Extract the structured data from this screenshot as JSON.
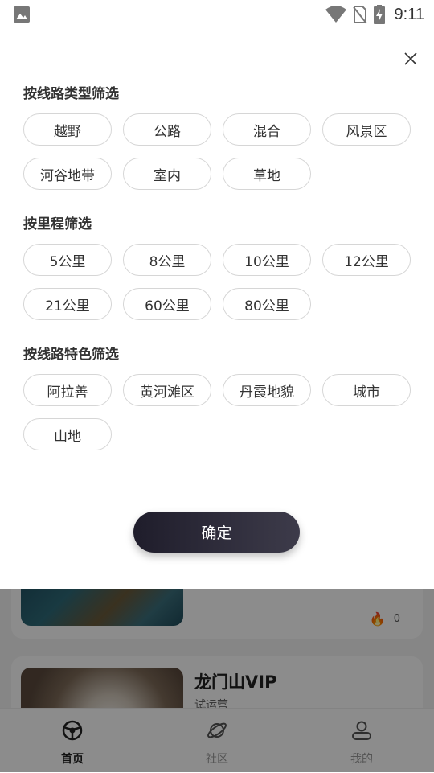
{
  "status_bar": {
    "time": "9:11"
  },
  "filter": {
    "sections": [
      {
        "title": "按线路类型筛选",
        "options": [
          "越野",
          "公路",
          "混合",
          "风景区",
          "河谷地带",
          "室内",
          "草地"
        ]
      },
      {
        "title": "按里程筛选",
        "options": [
          "5公里",
          "8公里",
          "10公里",
          "12公里",
          "21公里",
          "60公里",
          "80公里"
        ]
      },
      {
        "title": "按线路特色筛选",
        "options": [
          "阿拉善",
          "黄河滩区",
          "丹霞地貌",
          "城市",
          "山地"
        ]
      }
    ],
    "confirm_label": "确定"
  },
  "background_list": {
    "card1": {
      "hot_count": "0"
    },
    "card2": {
      "title": "龙门山VIP",
      "subtitle": "试运营"
    }
  },
  "tabbar": {
    "tabs": [
      {
        "label": "首页",
        "icon": "home-wheel-icon",
        "active": true
      },
      {
        "label": "社区",
        "icon": "planet-icon",
        "active": false
      },
      {
        "label": "我的",
        "icon": "user-icon",
        "active": false
      }
    ]
  },
  "colors": {
    "confirm_dark": "#1f1d2b",
    "flame": "#e0241b",
    "chip_border": "#d6d6d6"
  }
}
